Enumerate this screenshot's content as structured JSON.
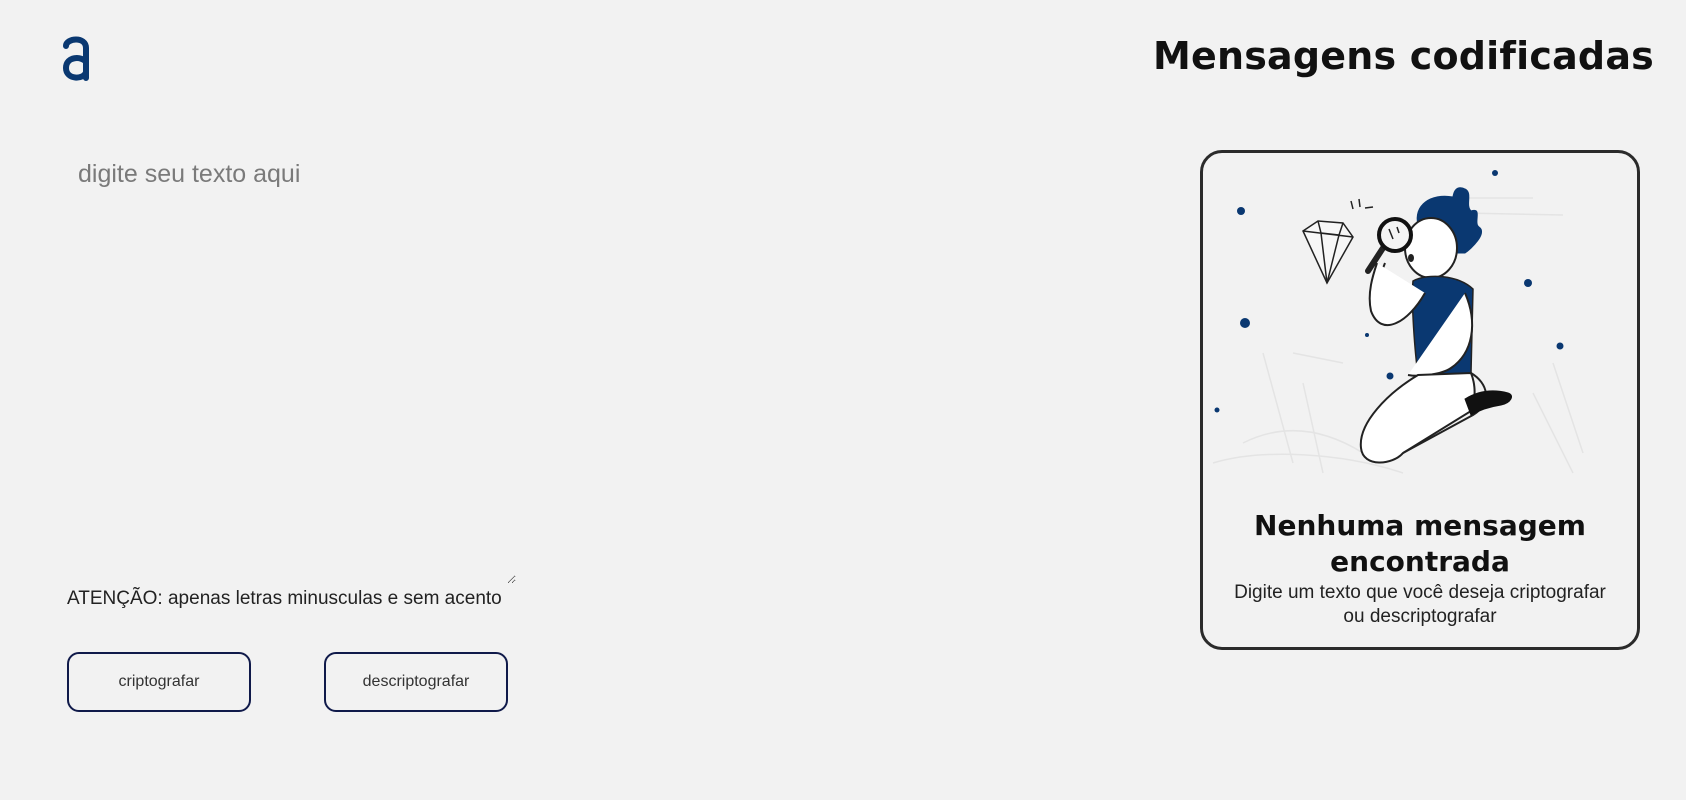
{
  "header": {
    "logo_icon": "alura-a-logo-icon",
    "title": "Mensagens codificadas"
  },
  "input": {
    "placeholder": "digite seu texto aqui",
    "value": ""
  },
  "warning": {
    "text": "ATENÇÃO: apenas letras minusculas e sem acento"
  },
  "buttons": {
    "encrypt_label": "criptografar",
    "decrypt_label": "descriptografar"
  },
  "output": {
    "illustration_icon": "person-with-magnifier-diamond-illustration",
    "title": "Nenhuma mensagem encontrada",
    "subtitle": "Digite um texto que você deseja criptografar ou descriptografar"
  },
  "colors": {
    "background": "#f2f2f2",
    "brand_blue": "#0a3871",
    "button_border": "#101a4a",
    "card_border": "#2b2b2b"
  }
}
